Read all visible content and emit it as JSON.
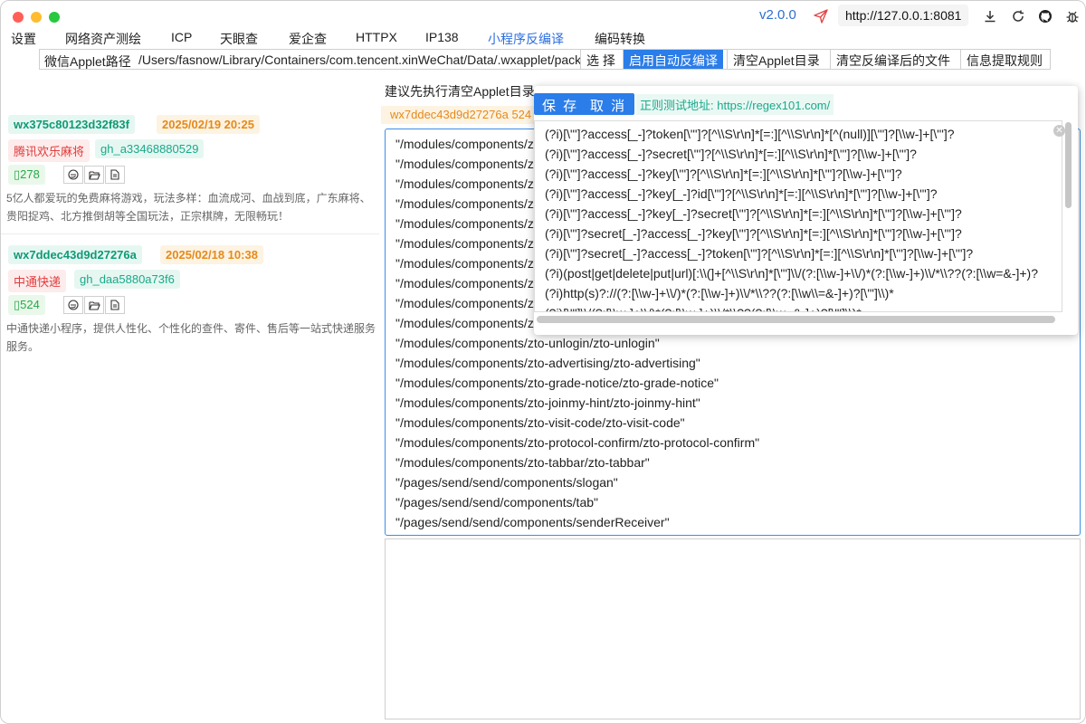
{
  "window": {
    "version": "v2.0.0",
    "server": "http://127.0.0.1:8081"
  },
  "menu": [
    "设置",
    "网络资产测绘",
    "ICP",
    "天眼查",
    "爱企查",
    "HTTPX",
    "IP138",
    "小程序反编译",
    "编码转换"
  ],
  "menu_active": "小程序反编译",
  "toolbar": {
    "path_label": "微信Applet路径",
    "path_value": "/Users/fasnow/Library/Containers/com.tencent.xinWeChat/Data/.wxapplet/packages",
    "select": "选 择",
    "auto_decompile": "启用自动反编译",
    "clear_applet": "清空Applet目录",
    "clear_decompiled": "清空反编译后的文件",
    "rules": "信息提取规则"
  },
  "applets": [
    {
      "appid": "wx375c80123d32f83f",
      "date": "2025/02/19 20:25",
      "name": "腾讯欢乐麻将",
      "gh": "gh_a33468880529",
      "count": "278",
      "desc": "5亿人都爱玩的免费麻将游戏，玩法多样：血流成河、血战到底，广东麻将、贵阳捉鸡、北方推倒胡等全国玩法，正宗棋牌，无限畅玩！"
    },
    {
      "appid": "wx7ddec43d9d27276a",
      "date": "2025/02/18 10:38",
      "name": "中通快递",
      "gh": "gh_daa5880a73f6",
      "count": "524",
      "desc": "中通快递小程序，提供人性化、个性化的查件、寄件、售后等一站式快递服务服务。"
    }
  ],
  "right": {
    "hint": "建议先执行清空Applet目录",
    "selected": "wx7ddec43d9d27276a 524"
  },
  "editor_lines": [
    "\"/modules/components/zto-",
    "\"/modules/components/zto-",
    "\"/modules/components/zto-",
    "\"/modules/components/zto-",
    "\"/modules/components/zto-",
    "\"/modules/components/zto-",
    "\"/modules/components/zto-",
    "\"/modules/components/zto-",
    "\"/modules/components/zto-",
    "\"/modules/components/zto-",
    "\"/modules/components/zto-unlogin/zto-unlogin\"",
    "\"/modules/components/zto-advertising/zto-advertising\"",
    "\"/modules/components/zto-grade-notice/zto-grade-notice\"",
    "\"/modules/components/zto-joinmy-hint/zto-joinmy-hint\"",
    "\"/modules/components/zto-visit-code/zto-visit-code\"",
    "\"/modules/components/zto-protocol-confirm/zto-protocol-confirm\"",
    "\"/modules/components/zto-tabbar/zto-tabbar\"",
    "\"/pages/send/send/components/slogan\"",
    "\"/pages/send/send/components/tab\"",
    "\"/pages/send/send/components/senderReceiver\""
  ],
  "popup": {
    "save": "保 存",
    "cancel": "取 消",
    "test_url": "正则测试地址: https://regex101.com/",
    "rules": [
      "(?i)[\\\"']?access[_-]?token[\\\"']?[^\\\\S\\r\\n]*[=:][^\\\\S\\r\\n]*[^(null)][\\\"']?[\\\\w-]+[\\\"']?",
      "(?i)[\\\"']?access[_-]?secret[\\\"']?[^\\\\S\\r\\n]*[=:][^\\\\S\\r\\n]*[\\\"']?[\\\\w-]+[\\\"']?",
      "(?i)[\\\"']?access[_-]?key[\\\"']?[^\\\\S\\r\\n]*[=:][^\\\\S\\r\\n]*[\\\"']?[\\\\w-]+[\\\"']?",
      "(?i)[\\\"']?access[_-]?key[_-]?id[\\\"']?[^\\\\S\\r\\n]*[=:][^\\\\S\\r\\n]*[\\\"']?[\\\\w-]+[\\\"']?",
      "(?i)[\\\"']?access[_-]?key[_-]?secret[\\\"']?[^\\\\S\\r\\n]*[=:][^\\\\S\\r\\n]*[\\\"']?[\\\\w-]+[\\\"']?",
      "(?i)[\\\"']?secret[_-]?access[_-]?key[\\\"']?[^\\\\S\\r\\n]*[=:][^\\\\S\\r\\n]*[\\\"']?[\\\\w-]+[\\\"']?",
      "(?i)[\\\"']?secret[_-]?access[_-]?token[\\\"']?[^\\\\S\\r\\n]*[=:][^\\\\S\\r\\n]*[\\\"']?[\\\\w-]+[\\\"']?",
      "(?i)(post|get|delete|put|url)[:\\\\(]+[^\\\\S\\r\\n]*[\\\"']\\\\/(?:[\\\\w-]+\\\\/)*(?:[\\\\w-]+)\\\\/*\\\\??(?:[\\\\w=&-]+)?",
      "(?i)http(s)?://(?:[\\\\w-]+\\\\/)*(?:[\\\\w-]+)\\\\/*\\\\??(?:[\\\\w\\\\=&-]+)?[\\\"']\\\\)*",
      "(?i)[\\\"']\\\\/(?:[\\\\w-]+\\\\/)*(?:[\\\\w-]+)\\\\/*\\\\??(?:[\\\\w=&-]+)?[\\\"']\\\\)*"
    ]
  }
}
